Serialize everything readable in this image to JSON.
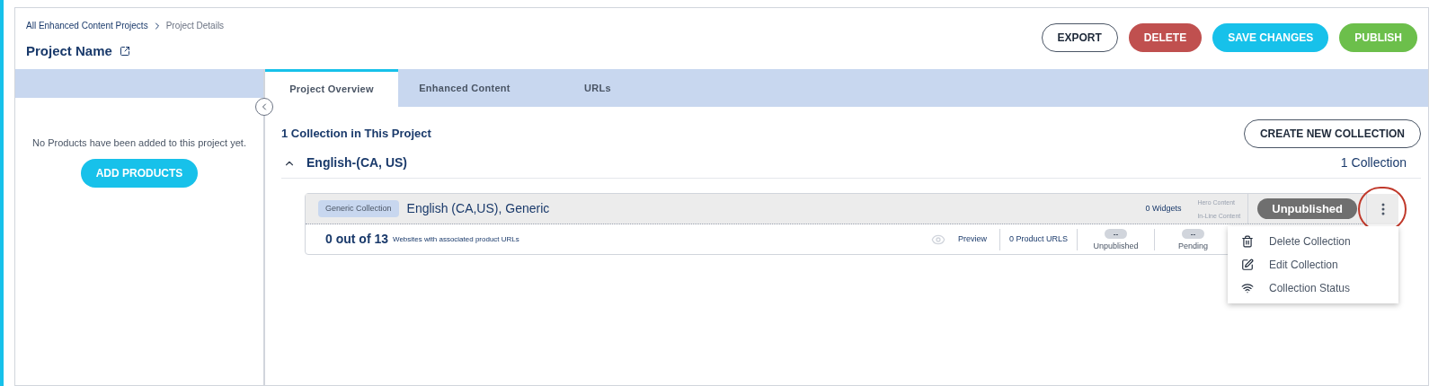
{
  "breadcrumb": {
    "parent": "All Enhanced Content Projects",
    "current": "Project Details"
  },
  "project_title": "Project Name",
  "actions": [
    {
      "label": "EXPORT",
      "kind": "outline"
    },
    {
      "label": "DELETE",
      "kind": "danger"
    },
    {
      "label": "SAVE CHANGES",
      "kind": "primary"
    },
    {
      "label": "PUBLISH",
      "kind": "success"
    }
  ],
  "sidebar": {
    "empty_message": "No Products have been added to this project yet.",
    "add_button": "ADD PRODUCTS"
  },
  "tabs": [
    {
      "label": "Project Overview",
      "selected": true
    },
    {
      "label": "Enhanced Content",
      "selected": false
    },
    {
      "label": "URLs",
      "selected": false
    }
  ],
  "overview": {
    "heading": "1 Collection in This Project",
    "create_button": "CREATE NEW COLLECTION",
    "group": {
      "title": "English-(CA, US)",
      "expanded": true,
      "count": "1 Collection",
      "collection": {
        "tag": "Generic Collection",
        "name": "English (CA,US), Generic",
        "widgets": "0 Widgets",
        "content_types": [
          "Hero Content",
          "In-Line Content"
        ],
        "status": "Unpublished",
        "websites_count": "0 out of 13",
        "websites_label": "Websites with associated product URLs",
        "preview": "Preview",
        "product_urls": "0 Product URLS",
        "chips": [
          {
            "value": "--",
            "label": "Unpublished"
          },
          {
            "value": "--",
            "label": "Pending"
          }
        ]
      }
    }
  },
  "menu": [
    {
      "label": "Delete Collection",
      "kind": "trash"
    },
    {
      "label": "Edit Collection",
      "kind": "edit"
    },
    {
      "label": "Collection Status",
      "kind": "wifi"
    }
  ]
}
